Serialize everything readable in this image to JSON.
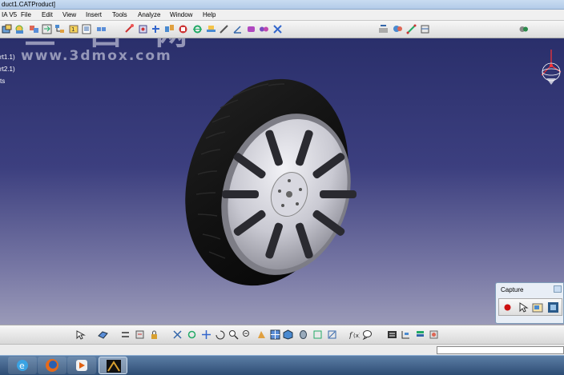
{
  "window": {
    "title": "duct1.CATProduct]"
  },
  "menu": {
    "items": [
      "IA V5",
      "File",
      "Edit",
      "View",
      "Insert",
      "Tools",
      "Analyze",
      "Window",
      "Help"
    ]
  },
  "tree": {
    "items": [
      "rt1.1)",
      "rt2.1)",
      "ts"
    ]
  },
  "watermark": {
    "glyphs": "三 西 网",
    "url": "www.3dmox.com"
  },
  "capture": {
    "title": "Capture"
  },
  "colors": {
    "viewport_top": "#2a2f6b",
    "viewport_bottom": "#9a9ab8",
    "record_button": "#cc1010"
  }
}
